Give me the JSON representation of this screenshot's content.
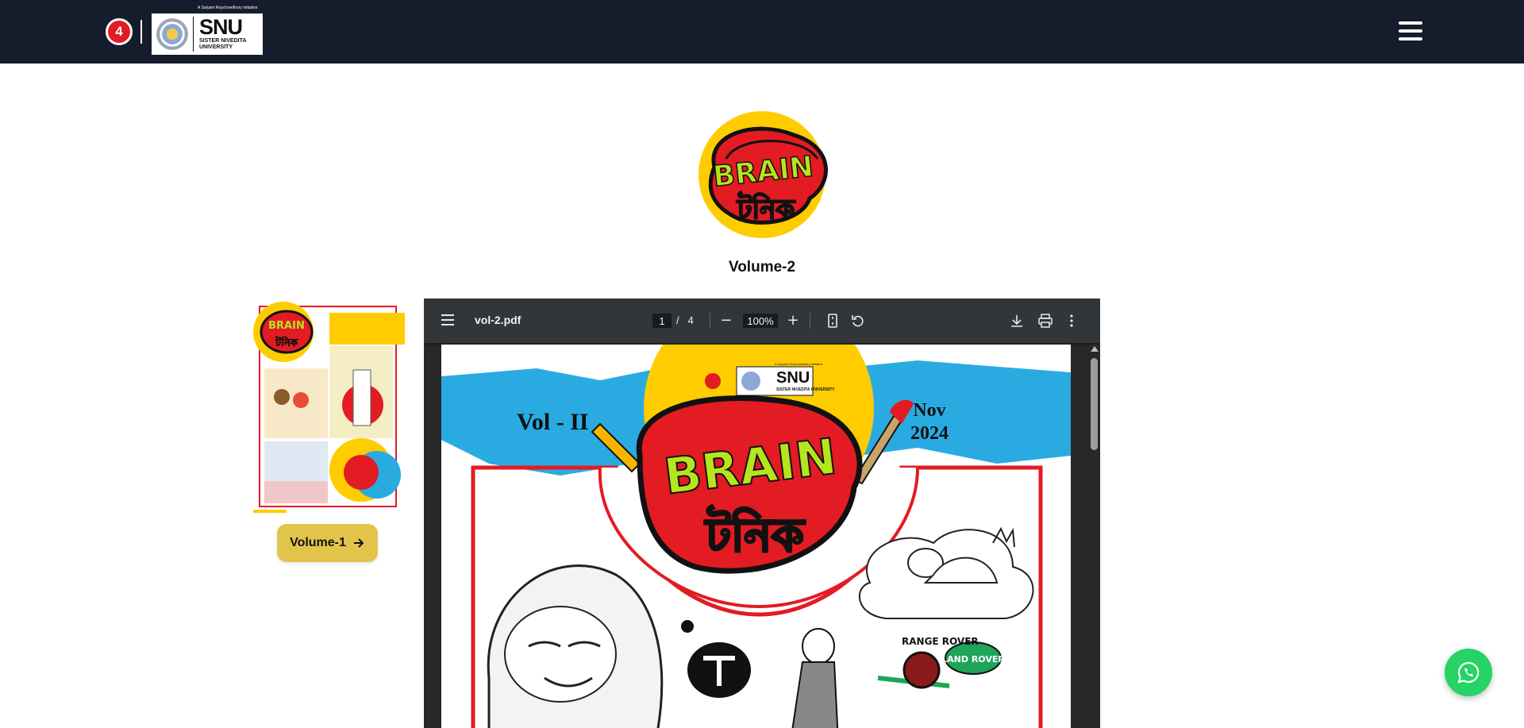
{
  "header": {
    "logo_letter": "4",
    "snu_tagline": "A Satyam Roychowdhury Initiative",
    "snu_title": "SNU",
    "snu_subtitle": "SISTER NIVEDITA UNIVERSITY"
  },
  "hero": {
    "logo_text_top": "BRAIN",
    "logo_text_bottom": "টনিক",
    "volume_title": "Volume-2"
  },
  "thumbnail": {
    "button_label": "Volume-1",
    "button_icon": "arrow-right-icon"
  },
  "pdf_viewer": {
    "filename": "vol-2.pdf",
    "current_page": "1",
    "page_separator": "/",
    "total_pages": "4",
    "zoom": "100%",
    "zoom_out_symbol": "−",
    "zoom_in_symbol": "+",
    "icons": [
      "menu-icon",
      "zoom-out-icon",
      "zoom-in-icon",
      "fit-page-icon",
      "rotate-icon",
      "download-icon",
      "print-icon",
      "more-options-icon"
    ]
  },
  "pdf_page": {
    "vol_label": "Vol - II",
    "date_month": "Nov",
    "date_year": "2024",
    "mini_snu": "SNU",
    "mini_snu_sub": "SISTER NIVEDITA UNIVERSITY",
    "mini_tag": "A Satyam Roychowdhury Initiative",
    "cover_text_top": "BRAIN",
    "cover_text_bottom": "টনিক",
    "range_rover_text": "RANGE ROVER",
    "land_rover_text": "LAND ROVER"
  },
  "colors": {
    "header_bg": "#151c2b",
    "button_yellow": "#e3c44b",
    "brand_red": "#e31b23",
    "brand_green": "#b5e61d",
    "sky_blue": "#29abe2",
    "whatsapp_green": "#25d366"
  }
}
